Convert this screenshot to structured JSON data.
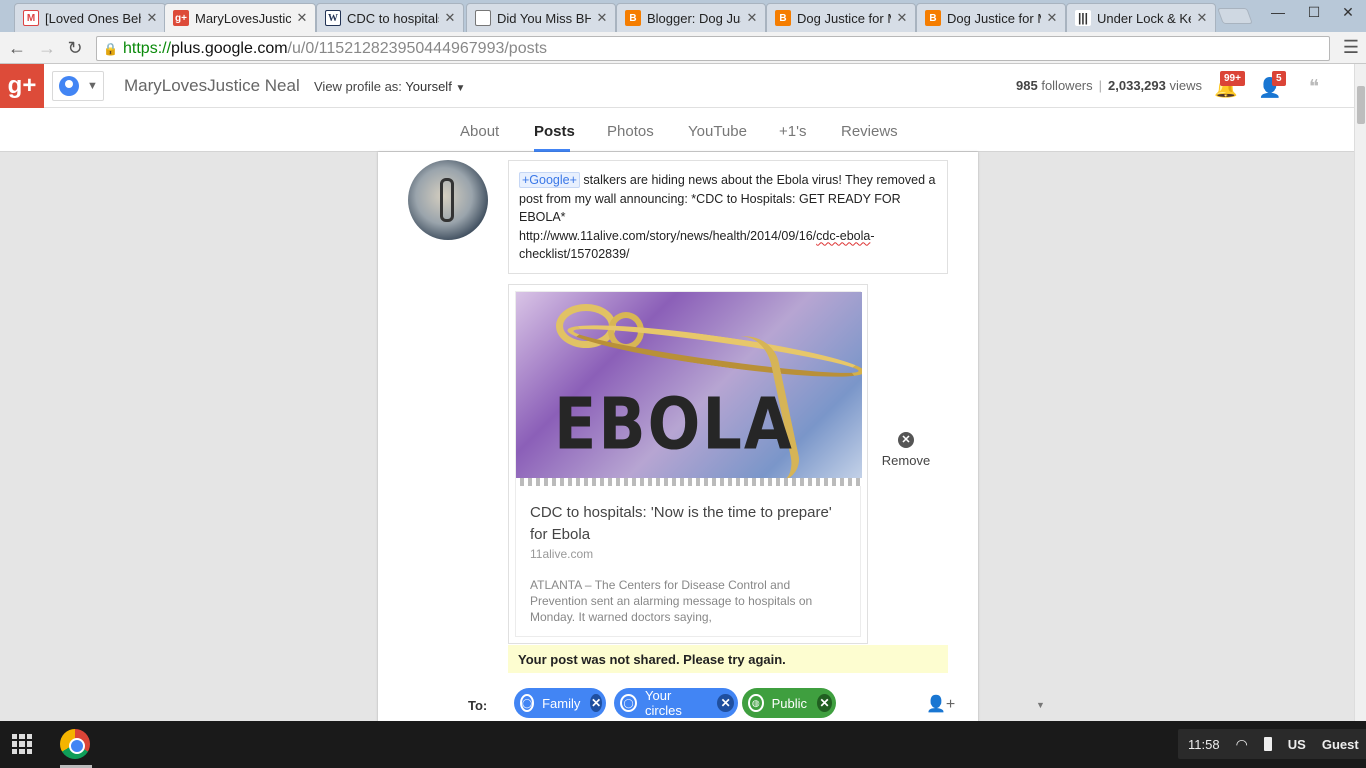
{
  "browser": {
    "tabs": [
      {
        "title": "[Loved Ones Beh",
        "favicon": "gmail-icon"
      },
      {
        "title": "MaryLovesJustice",
        "favicon": "google-plus-icon",
        "active": true
      },
      {
        "title": "CDC to hospitals:",
        "favicon": "wiki-icon"
      },
      {
        "title": "Did You Miss BH",
        "favicon": "document-icon"
      },
      {
        "title": "Blogger: Dog Just",
        "favicon": "blogger-icon"
      },
      {
        "title": "Dog Justice for M",
        "favicon": "blogger-icon"
      },
      {
        "title": "Dog Justice for M",
        "favicon": "blogger-icon"
      },
      {
        "title": "Under Lock & Key",
        "favicon": "bars-icon"
      }
    ],
    "url": {
      "scheme": "https://",
      "host": "plus.google.com",
      "path": "/u/0/115212823950444967993/posts"
    }
  },
  "gbar": {
    "profile_name": "MaryLovesJustice Neal",
    "view_profile_label": "View profile as:",
    "view_profile_value": "Yourself",
    "followers_count": "985",
    "followers_label": "followers",
    "views_count": "2,033,293",
    "views_label": "views",
    "notifications_badge": "99+",
    "people_badge": "5"
  },
  "profile_tabs": [
    {
      "label": "About"
    },
    {
      "label": "Posts",
      "active": true
    },
    {
      "label": "Photos"
    },
    {
      "label": "YouTube"
    },
    {
      "label": "+1's"
    },
    {
      "label": "Reviews"
    }
  ],
  "post": {
    "mention": "+Google+",
    "text_1": " stalkers are hiding news about the Ebola virus! They removed a post from my wall announcing: *CDC to Hospitals: GET READY FOR EBOLA*",
    "link_a": "http://www.11alive.com/story/news/health/2014/09/16/",
    "link_b": "cdc-ebola",
    "link_c": "-",
    "link_d": "checklist/15702839/"
  },
  "link_card": {
    "image_word": "EBOLA",
    "title": "CDC to hospitals: 'Now is the time to prepare' for Ebola",
    "domain": "11alive.com",
    "description": "ATLANTA – The Centers for Disease Control and Prevention sent an alarming message to hospitals on Monday. It warned doctors saying,"
  },
  "remove_label": "Remove",
  "error_message": "Your post was not shared. Please try again.",
  "share_to": {
    "label": "To:",
    "chips": [
      {
        "label": "Family",
        "color": "#4285f4"
      },
      {
        "label": "Your circles",
        "color": "#4285f4"
      },
      {
        "label": "Public",
        "color": "#3f9f3f"
      }
    ]
  },
  "system_tray": {
    "time": "11:58",
    "keyboard": "US",
    "user": "Guest"
  }
}
